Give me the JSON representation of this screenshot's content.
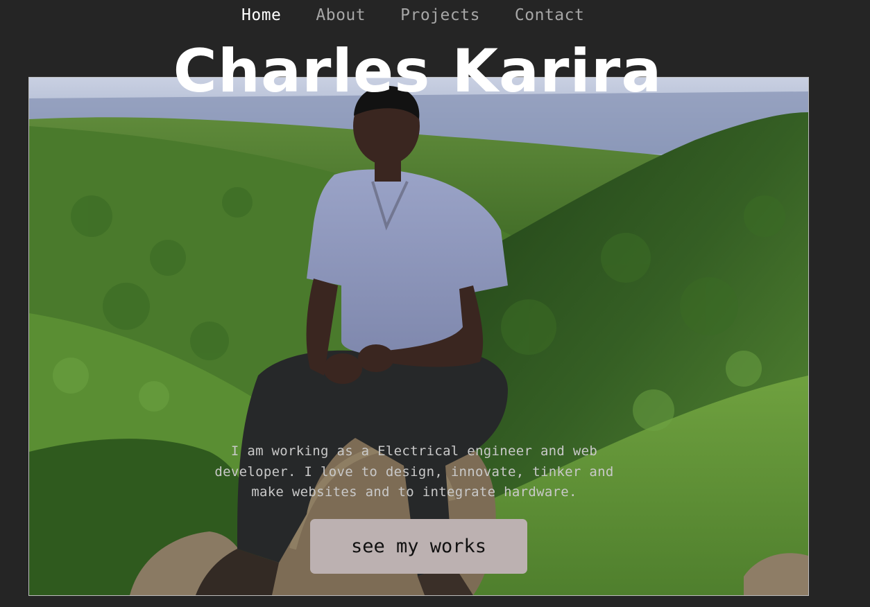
{
  "nav": {
    "items": [
      {
        "label": "Home",
        "active": true
      },
      {
        "label": "About",
        "active": false
      },
      {
        "label": "Projects",
        "active": false
      },
      {
        "label": "Contact",
        "active": false
      }
    ]
  },
  "hero": {
    "title": "Charles Karira",
    "intro": "I am working as a Electrical engineer and web developer. I love to design, innovate, tinker and make websites and to integrate hardware.",
    "cta_label": "see my works",
    "photo_description": "portrait-photo"
  },
  "colors": {
    "background": "#252525",
    "nav_active": "#ffffff",
    "nav_inactive": "#a7a7a7",
    "button_bg": "#bcb1b1"
  }
}
